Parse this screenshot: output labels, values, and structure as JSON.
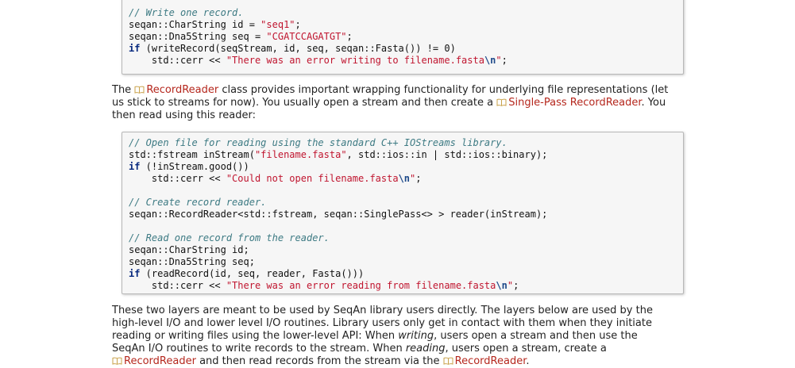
{
  "code_block_1": {
    "lines": [
      [
        {
          "t": "cm",
          "v": "// Write one record."
        }
      ],
      [
        {
          "t": "",
          "v": "seqan::CharString id = "
        },
        {
          "t": "st",
          "v": "\"seq1\""
        },
        {
          "t": "",
          "v": ";"
        }
      ],
      [
        {
          "t": "",
          "v": "seqan::Dna5String seq = "
        },
        {
          "t": "st",
          "v": "\"CGATCCAGATGT\""
        },
        {
          "t": "",
          "v": ";"
        }
      ],
      [
        {
          "t": "kw",
          "v": "if"
        },
        {
          "t": "",
          "v": " (writeRecord(seqStream, id, seq, seqan::Fasta()) != 0)"
        }
      ],
      [
        {
          "t": "",
          "v": "    std::cerr << "
        },
        {
          "t": "st",
          "v": "\"There was an error writing to filename.fasta"
        },
        {
          "t": "esc",
          "v": "\\n"
        },
        {
          "t": "st",
          "v": "\""
        },
        {
          "t": "",
          "v": ";"
        }
      ]
    ]
  },
  "paragraph_1": {
    "line1_pre": "The ",
    "link_record_reader": "RecordReader",
    "line1_post": " class provides important wrapping functionality for underlying file representations (let",
    "line2_pre": "us stick to streams for now). You usually open a stream and then create a ",
    "link_single_pass": "Single-Pass RecordReader",
    "line2_post": ". You",
    "line3": "then read using this reader:"
  },
  "code_block_2": {
    "lines": [
      [
        {
          "t": "cm",
          "v": "// Open file for reading using the standard C++ IOStreams library."
        }
      ],
      [
        {
          "t": "",
          "v": "std::fstream inStream("
        },
        {
          "t": "st",
          "v": "\"filename.fasta\""
        },
        {
          "t": "",
          "v": ", std::ios::in | std::ios::binary);"
        }
      ],
      [
        {
          "t": "kw",
          "v": "if"
        },
        {
          "t": "",
          "v": " (!inStream.good())"
        }
      ],
      [
        {
          "t": "",
          "v": "    std::cerr << "
        },
        {
          "t": "st",
          "v": "\"Could not open filename.fasta"
        },
        {
          "t": "esc",
          "v": "\\n"
        },
        {
          "t": "st",
          "v": "\""
        },
        {
          "t": "",
          "v": ";"
        }
      ],
      [
        {
          "t": "",
          "v": ""
        }
      ],
      [
        {
          "t": "cm",
          "v": "// Create record reader."
        }
      ],
      [
        {
          "t": "",
          "v": "seqan::RecordReader<std::fstream, seqan::SinglePass<> > reader(inStream);"
        }
      ],
      [
        {
          "t": "",
          "v": ""
        }
      ],
      [
        {
          "t": "cm",
          "v": "// Read one record from the reader."
        }
      ],
      [
        {
          "t": "",
          "v": "seqan::CharString id;"
        }
      ],
      [
        {
          "t": "",
          "v": "seqan::Dna5String seq;"
        }
      ],
      [
        {
          "t": "kw",
          "v": "if"
        },
        {
          "t": "",
          "v": " (readRecord(id, seq, reader, Fasta()))"
        }
      ],
      [
        {
          "t": "",
          "v": "    std::cerr << "
        },
        {
          "t": "st",
          "v": "\"There was an error reading from filename.fasta"
        },
        {
          "t": "esc",
          "v": "\\n"
        },
        {
          "t": "st",
          "v": "\""
        },
        {
          "t": "",
          "v": ";"
        }
      ]
    ]
  },
  "paragraph_2": {
    "line1": "These two layers are meant to be used by SeqAn library users directly. The layers below are used by the",
    "line2": "high-level I/O and lower level I/O routines. Library users only get in contact with them when they initiate",
    "line3_pre": "reading or writing files using the lower-level API: When ",
    "line3_em": "writing",
    "line3_post": ", users open a stream and then use the",
    "line4_pre": "SeqAn I/O routines to write records to the stream. When ",
    "line4_em": "reading",
    "line4_post": ", users open a stream, create a",
    "link_record_reader_a": "RecordReader",
    "line5_mid": " and then read records from the stream via the ",
    "link_record_reader_b": "RecordReader",
    "line5_post": "."
  },
  "colors": {
    "link": "#b5271d",
    "comment": "#3d7a83",
    "string": "#c0152f",
    "keyword": "#06287e",
    "code_background": "#f6f6f6"
  },
  "icons": {
    "link_icon": "book-icon"
  }
}
